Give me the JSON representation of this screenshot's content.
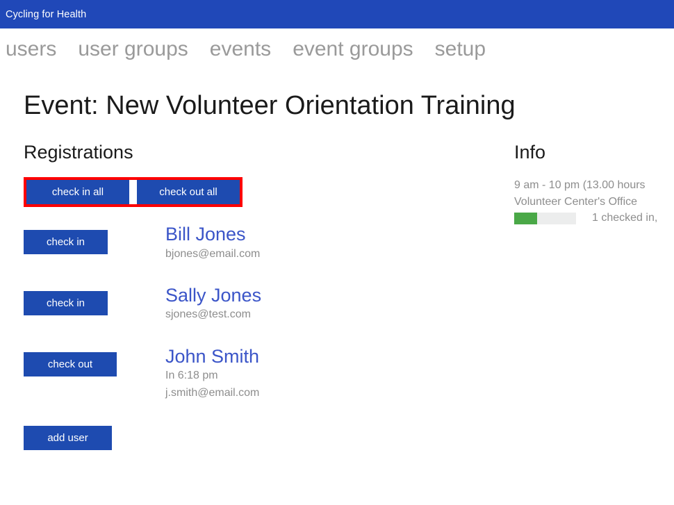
{
  "titlebar": {
    "title": "Cycling for Health"
  },
  "nav": {
    "items": [
      {
        "label": "users"
      },
      {
        "label": "user groups"
      },
      {
        "label": "events"
      },
      {
        "label": "event groups"
      },
      {
        "label": "setup"
      }
    ]
  },
  "page": {
    "title": "Event: New Volunteer Orientation Training"
  },
  "registrations": {
    "heading": "Registrations",
    "bulk_actions": {
      "check_in_all": "check in all",
      "check_out_all": "check out all"
    },
    "rows": [
      {
        "action_label": "check in",
        "name": "Bill Jones",
        "time": "",
        "email": "bjones@email.com"
      },
      {
        "action_label": "check in",
        "name": "Sally Jones",
        "time": "",
        "email": "sjones@test.com"
      },
      {
        "action_label": "check out",
        "name": "John Smith",
        "time": "In 6:18 pm",
        "email": "j.smith@email.com"
      }
    ],
    "add_user_label": "add user"
  },
  "info": {
    "heading": "Info",
    "hours": "9 am - 10 pm (13.00 hours",
    "location": "Volunteer Center's Office",
    "progress_label": "1 checked in,"
  },
  "colors": {
    "titlebar_blue": "#2048b8",
    "button_blue": "#1e4bb0",
    "link_blue": "#3b55c8",
    "highlight_red": "#fe0000",
    "progress_green": "#4aa847",
    "progress_track": "#eceded",
    "muted_gray": "#8d8d8d",
    "nav_gray": "#9a9a9a"
  }
}
